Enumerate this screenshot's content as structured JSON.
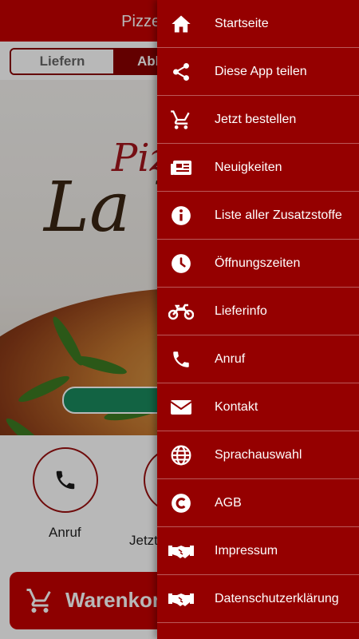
{
  "header": {
    "title": "Pizzeria La Vera"
  },
  "order_mode": {
    "option_1": "Liefern",
    "option_2": "Abholen"
  },
  "hero": {
    "script_line_1": "Pizzeria",
    "script_line_2": "La Vera"
  },
  "actions": [
    {
      "label": "Anruf",
      "icon": "phone-icon"
    },
    {
      "label": "Jetzt bestellen",
      "icon": "cart-icon"
    }
  ],
  "cart": {
    "label": "Warenkorb",
    "icon": "cart-icon"
  },
  "drawer": {
    "items": [
      {
        "label": "Startseite",
        "icon": "home-icon"
      },
      {
        "label": "Diese App teilen",
        "icon": "share-icon"
      },
      {
        "label": "Jetzt bestellen",
        "icon": "cart-icon"
      },
      {
        "label": "Neuigkeiten",
        "icon": "news-icon"
      },
      {
        "label": "Liste aller Zusatzstoffe",
        "icon": "info-icon"
      },
      {
        "label": "Öffnungszeiten",
        "icon": "clock-icon"
      },
      {
        "label": "Lieferinfo",
        "icon": "motorcycle-icon"
      },
      {
        "label": "Anruf",
        "icon": "phone-icon"
      },
      {
        "label": "Kontakt",
        "icon": "mail-icon"
      },
      {
        "label": "Sprachauswahl",
        "icon": "globe-icon"
      },
      {
        "label": "AGB",
        "icon": "copyright-icon"
      },
      {
        "label": "Impressum",
        "icon": "handshake-icon"
      },
      {
        "label": "Datenschutzerklärung",
        "icon": "handshake-icon"
      }
    ]
  },
  "colors": {
    "brand_red": "#c40000",
    "drawer_red": "#950000",
    "accent_green": "#1a8a5e"
  }
}
